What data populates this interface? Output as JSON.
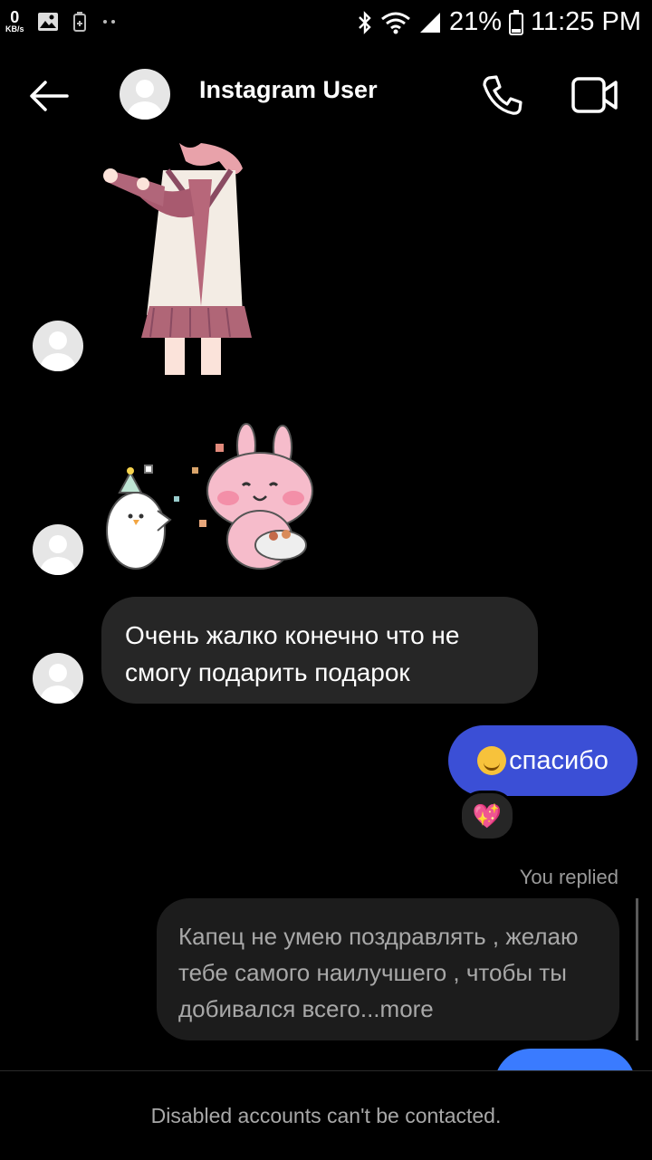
{
  "status_bar": {
    "speed_value": "0",
    "speed_unit": "KB/s",
    "battery": "21%",
    "time": "11:25 PM"
  },
  "header": {
    "title": "Instagram User",
    "icons": [
      "back-arrow-icon",
      "phone-icon",
      "video-camera-icon"
    ]
  },
  "messages": {
    "incoming_text": "Очень жалко конечно что не смогу подарить подарок",
    "outgoing_text": "спасибо",
    "reaction_emoji": "💖",
    "you_replied_label": "You replied",
    "reply_text": "Капец не умею поздравлять , желаю тебе самого наилучшего , чтобы ты добивался всего",
    "reply_more": "...more"
  },
  "footer": {
    "notice": "Disabled accounts can't be contacted."
  },
  "colors": {
    "incoming_bubble": "#262626",
    "outgoing_bubble": "#3b4fd6",
    "background": "#000000"
  }
}
